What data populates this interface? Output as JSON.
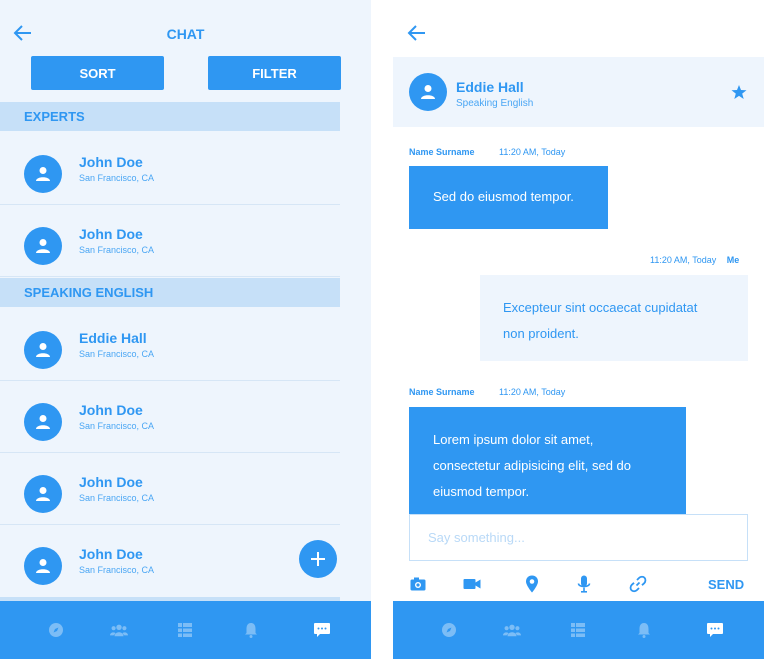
{
  "colors": {
    "accent": "#2f97f2",
    "light": "#eef5fd",
    "section": "#c6e0f8"
  },
  "left": {
    "title": "CHAT",
    "sort_label": "SORT",
    "filter_label": "FILTER",
    "sections": [
      {
        "label": "EXPERTS",
        "contacts": [
          {
            "name": "John Doe",
            "location": "San Francisco, CA"
          },
          {
            "name": "John Doe",
            "location": "San Francisco, CA"
          }
        ]
      },
      {
        "label": "SPEAKING ENGLISH",
        "contacts": [
          {
            "name": "Eddie Hall",
            "location": "San Francisco, CA"
          },
          {
            "name": "John Doe",
            "location": "San Francisco, CA"
          },
          {
            "name": "John Doe",
            "location": "San Francisco, CA"
          },
          {
            "name": "John Doe",
            "location": "San Francisco, CA"
          }
        ]
      }
    ],
    "nav_icons": [
      "compass-icon",
      "group-icon",
      "list-icon",
      "bell-icon",
      "chat-icon"
    ],
    "active_nav": "chat-icon"
  },
  "right": {
    "contact_name": "Eddie Hall",
    "contact_subtitle": "Speaking English",
    "messages": [
      {
        "sender": "Name Surname",
        "time": "11:20 AM, Today",
        "text": "Sed do eiusmod tempor."
      },
      {
        "sender": "Me",
        "time": "11:20 AM, Today",
        "text_lines": [
          "Excepteur sint occaecat cupidatat",
          "non proident."
        ]
      },
      {
        "sender": "Name Surname",
        "time": "11:20 AM, Today",
        "text_lines": [
          "Lorem ipsum dolor sit amet,",
          "consectetur adipisicing elit, sed do",
          "eiusmod tempor."
        ]
      }
    ],
    "input_placeholder": "Say something...",
    "send_label": "SEND",
    "tool_icons": [
      "camera-icon",
      "video-icon",
      "location-icon",
      "microphone-icon",
      "link-icon"
    ]
  }
}
